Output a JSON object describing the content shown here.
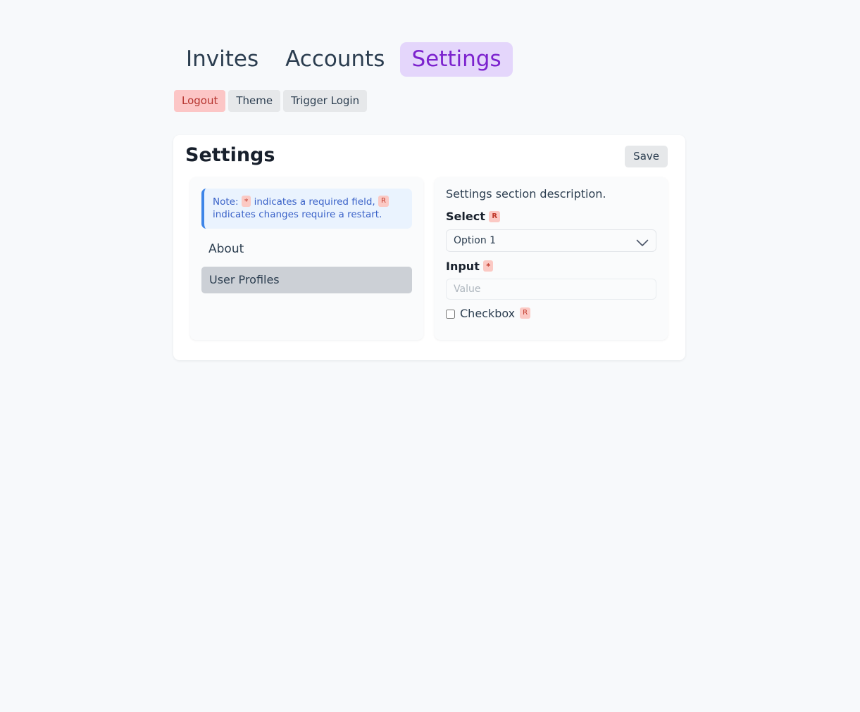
{
  "nav": {
    "tabs": [
      {
        "label": "Invites",
        "active": false
      },
      {
        "label": "Accounts",
        "active": false
      },
      {
        "label": "Settings",
        "active": true
      }
    ]
  },
  "actions": {
    "logout_label": "Logout",
    "theme_label": "Theme",
    "trigger_login_label": "Trigger Login"
  },
  "card": {
    "title": "Settings",
    "save_label": "Save"
  },
  "left_panel": {
    "note": {
      "prefix": "Note:",
      "required_badge": "*",
      "middle": "indicates a required field,",
      "restart_badge": "R",
      "suffix": "indicates changes require a restart."
    },
    "section_label": "About",
    "items": [
      {
        "label": "User Profiles",
        "selected": true
      }
    ]
  },
  "right_panel": {
    "description": "Settings section description.",
    "select_field": {
      "label": "Select",
      "badge": "R",
      "value": "Option 1",
      "options": [
        "Option 1"
      ],
      "chevron_icon": "chevron-down-icon"
    },
    "input_field": {
      "label": "Input",
      "badge": "*",
      "value": "",
      "placeholder": "Value"
    },
    "checkbox_field": {
      "label": "Checkbox",
      "badge": "R",
      "checked": false
    }
  },
  "colors": {
    "page_background": "#f7f9fb",
    "card_background": "#ffffff",
    "panel_background": "#fafbfc",
    "active_tab_background": "#e4d6fb",
    "active_tab_text": "#7c22ce",
    "danger_background": "#fcc6c6",
    "danger_text": "#b5332e",
    "badge_background": "#fbc9c4",
    "badge_text": "#c0392b",
    "note_background": "#eaf3fe",
    "note_border": "#3d85e8",
    "note_text": "#3a62c8",
    "selected_item_background": "#ccd0d6"
  }
}
